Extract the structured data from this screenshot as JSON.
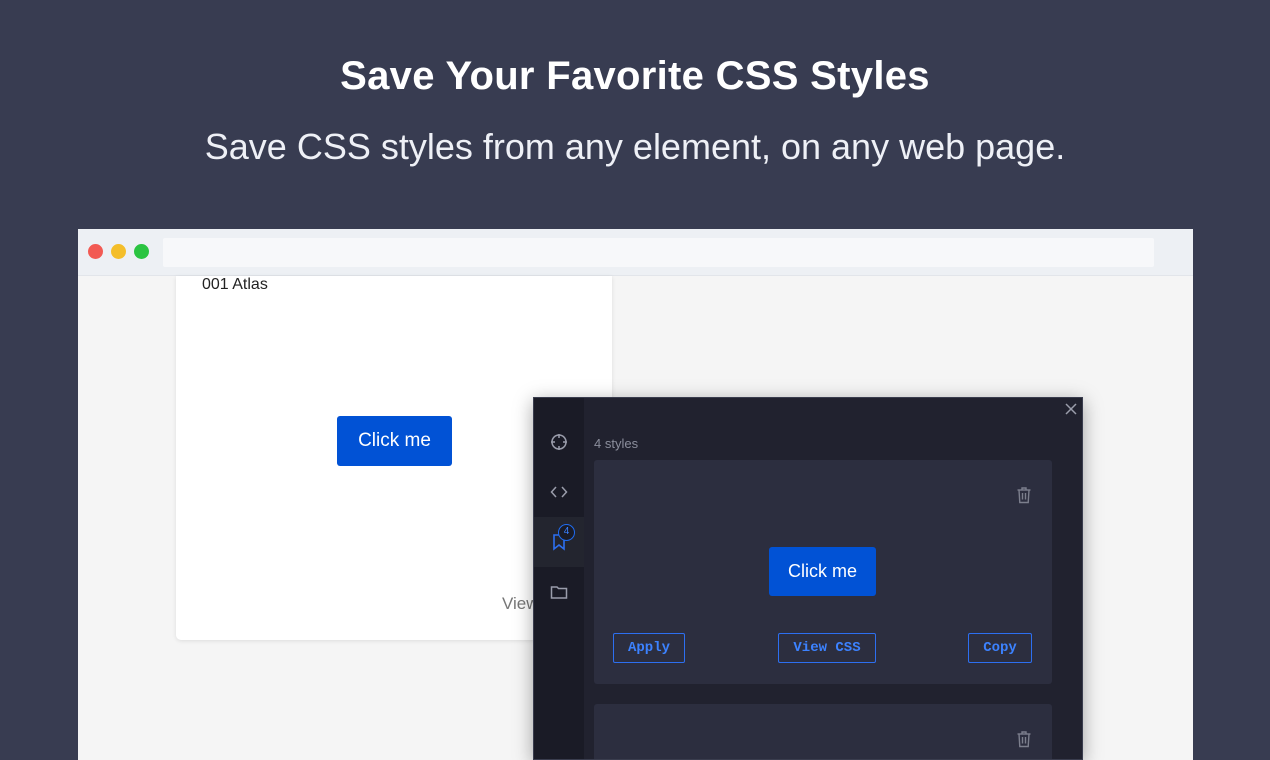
{
  "hero": {
    "title": "Save Your Favorite CSS Styles",
    "subtitle": "Save CSS styles from any element, on any web page."
  },
  "browser": {
    "dots": [
      "red",
      "yellow",
      "green"
    ],
    "address": ""
  },
  "page_card": {
    "name": "001 Atlas",
    "button_label": "Click me",
    "view_link": "View"
  },
  "extension": {
    "sidebar": [
      {
        "icon": "crosshair-icon"
      },
      {
        "icon": "code-icon"
      },
      {
        "icon": "bookmark-icon",
        "badge": "4",
        "active": true
      },
      {
        "icon": "folder-icon"
      }
    ],
    "styles_count": "4 styles",
    "cards": [
      {
        "preview_label": "Click me",
        "actions": {
          "apply": "Apply",
          "view_css": "View CSS",
          "copy": "Copy"
        }
      }
    ]
  },
  "colors": {
    "background": "#383c51",
    "accent": "#0152d5",
    "panel": "#21222f",
    "card": "#2c2e3f"
  }
}
